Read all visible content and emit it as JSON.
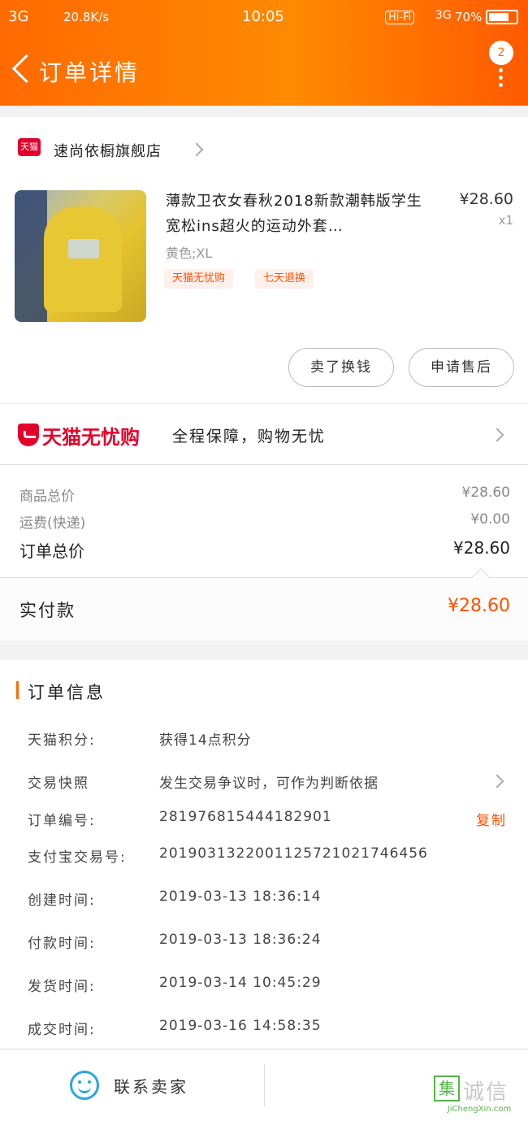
{
  "status_bar": {
    "network": "3G",
    "speed": "20.8K/s",
    "time": "10:05",
    "hifi": "Hi-Fi",
    "network2": "3G",
    "battery": "70%"
  },
  "nav": {
    "title": "订单详情",
    "badge": "2"
  },
  "shop": {
    "logo_text": "天猫",
    "name": "速尚依橱旗舰店"
  },
  "product": {
    "title": "薄款卫衣女春秋2018新款潮韩版学生宽松ins超火的运动外套…",
    "price": "¥28.60",
    "qty": "x1",
    "sku": "黄色;XL",
    "tags": [
      "天猫无忧购",
      "七天退换"
    ],
    "actions": [
      "卖了换钱",
      "申请售后"
    ]
  },
  "guarantee": {
    "brand": "天猫无忧购",
    "desc": "全程保障，购物无忧"
  },
  "summary": {
    "rows": [
      {
        "label": "商品总价",
        "value": "¥28.60"
      },
      {
        "label": "运费(快递)",
        "value": "¥0.00"
      },
      {
        "label": "订单总价",
        "value": "¥28.60"
      }
    ],
    "paid_label": "实付款",
    "paid_value": "¥28.60"
  },
  "order_info": {
    "title": "订单信息",
    "rows": [
      {
        "label": "天猫积分:",
        "value": "获得14点积分"
      },
      {
        "label": "交易快照",
        "value": "发生交易争议时，可作为判断依据"
      },
      {
        "label": "订单编号:",
        "value": "281976815444182901"
      },
      {
        "label": "支付宝交易号:",
        "value": "2019031322001125721021746456"
      },
      {
        "label": "创建时间:",
        "value": "2019-03-13 18:36:14"
      },
      {
        "label": "付款时间:",
        "value": "2019-03-13 18:36:24"
      },
      {
        "label": "发货时间:",
        "value": "2019-03-14 10:45:29"
      },
      {
        "label": "成交时间:",
        "value": "2019-03-16 14:58:35"
      }
    ],
    "copy_label": "复制"
  },
  "footer": {
    "contact": "联系卖家",
    "watermark": "诚信",
    "watermark_box": "集",
    "watermark_url": "JiChengXin.com"
  }
}
